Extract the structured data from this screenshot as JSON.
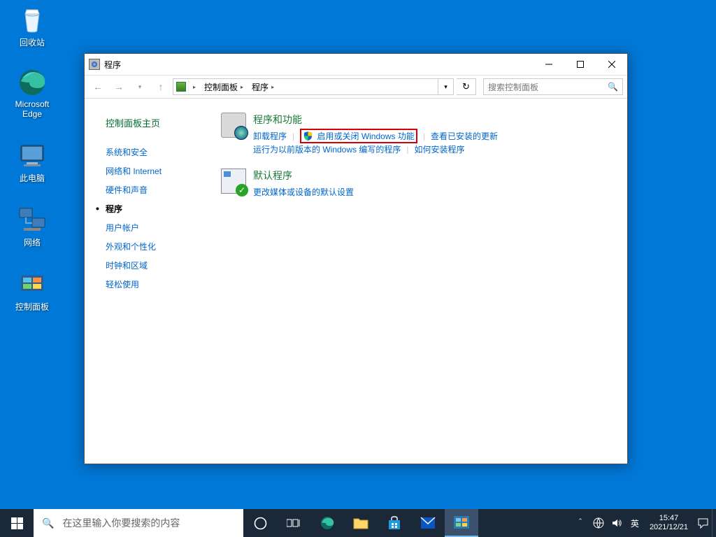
{
  "desktop": {
    "icons": [
      {
        "label": "回收站"
      },
      {
        "label": "Microsoft Edge"
      },
      {
        "label": "此电脑"
      },
      {
        "label": "网络"
      },
      {
        "label": "控制面板"
      }
    ]
  },
  "window": {
    "title": "程序",
    "breadcrumbs": [
      "控制面板",
      "程序"
    ],
    "search_placeholder": "搜索控制面板"
  },
  "sidebar": {
    "home": "控制面板主页",
    "items": [
      "系统和安全",
      "网络和 Internet",
      "硬件和声音",
      "程序",
      "用户帐户",
      "外观和个性化",
      "时钟和区域",
      "轻松使用"
    ],
    "active_index": 3
  },
  "sections": [
    {
      "title": "程序和功能",
      "links_row1": [
        "卸载程序",
        "启用或关闭 Windows 功能",
        "查看已安装的更新"
      ],
      "links_row2": [
        "运行为以前版本的 Windows 编写的程序",
        "如何安装程序"
      ]
    },
    {
      "title": "默认程序",
      "links_row1": [
        "更改媒体或设备的默认设置"
      ]
    }
  ],
  "taskbar": {
    "search_placeholder": "在这里输入你要搜索的内容",
    "ime": "英",
    "time": "15:47",
    "date": "2021/12/21"
  }
}
